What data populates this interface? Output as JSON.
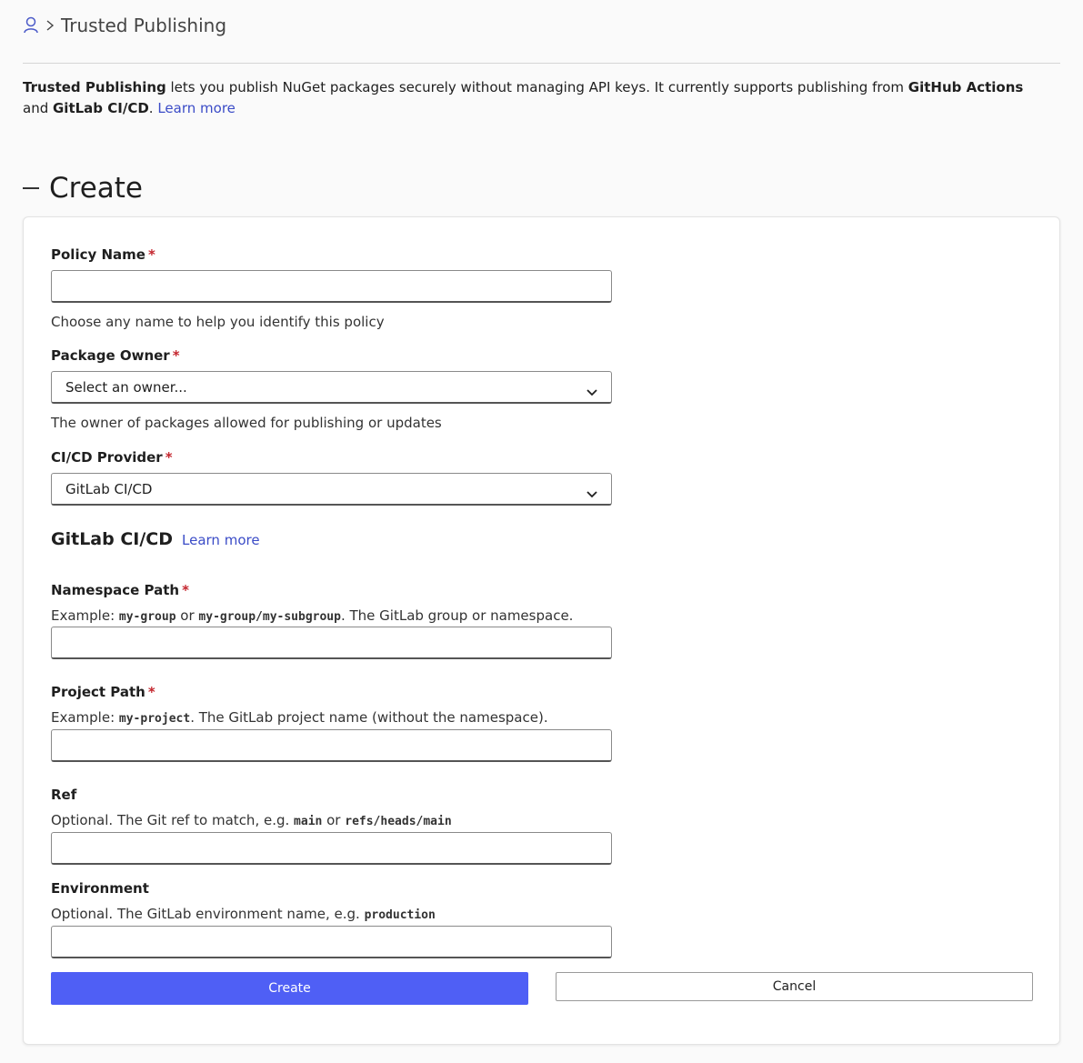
{
  "breadcrumb": {
    "icon": "user-icon",
    "separator_icon": "chevron-right-icon",
    "current": "Trusted Publishing"
  },
  "intro": {
    "bold_1": "Trusted Publishing",
    "text_1": " lets you publish NuGet packages securely without managing API keys. It currently supports publishing from ",
    "bold_2": "GitHub Actions",
    "text_2": " and ",
    "bold_3": "GitLab CI/CD",
    "text_3": ". ",
    "link": "Learn more"
  },
  "section": {
    "title": "Create",
    "collapse_icon": "minus-icon"
  },
  "form": {
    "required_marker": "*",
    "policy_name": {
      "label": "Policy Name",
      "value": "",
      "help": "Choose any name to help you identify this policy"
    },
    "package_owner": {
      "label": "Package Owner",
      "selected": "Select an owner...",
      "help": "The owner of packages allowed for publishing or updates"
    },
    "provider": {
      "label": "CI/CD Provider",
      "selected": "GitLab CI/CD"
    },
    "provider_section": {
      "title": "GitLab CI/CD",
      "link": "Learn more"
    },
    "namespace": {
      "label": "Namespace Path",
      "help_prefix": "Example: ",
      "code_1": "my-group",
      "help_mid": " or ",
      "code_2": "my-group/my-subgroup",
      "help_suffix": ". The GitLab group or namespace.",
      "value": ""
    },
    "project": {
      "label": "Project Path",
      "help_prefix": "Example: ",
      "code_1": "my-project",
      "help_suffix": ". The GitLab project name (without the namespace).",
      "value": ""
    },
    "ref": {
      "label": "Ref",
      "help_prefix": "Optional. The Git ref to match, e.g. ",
      "code_1": "main",
      "help_mid": " or ",
      "code_2": "refs/heads/main",
      "value": ""
    },
    "environment": {
      "label": "Environment",
      "help_prefix": "Optional. The GitLab environment name, e.g. ",
      "code_1": "production",
      "value": ""
    },
    "create_button": "Create",
    "cancel_button": "Cancel"
  },
  "colors": {
    "primary": "#4f5ff5",
    "link": "#3b4cc7",
    "required": "#c4262e"
  }
}
